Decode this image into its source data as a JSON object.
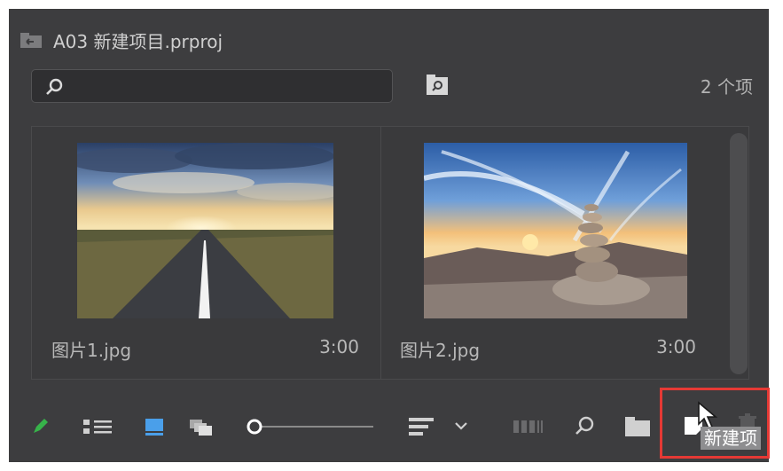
{
  "project": {
    "title": "A03 新建项目.prproj"
  },
  "search": {
    "placeholder": ""
  },
  "item_count": "2 个项",
  "items": [
    {
      "name": "图片1.jpg",
      "duration": "3:00",
      "thumbnail": "road-sunset-thumbnail"
    },
    {
      "name": "图片2.jpg",
      "duration": "3:00",
      "thumbnail": "stone-cairn-sunset-thumbnail"
    }
  ],
  "toolbar": {
    "zoom_level": 0.0,
    "tooltip": "新建项",
    "buttons": [
      "pencil-icon",
      "list-view-icon",
      "icon-view-icon",
      "freeform-view-icon",
      "zoom-slider",
      "sort-icon",
      "chevron-down-icon",
      "automate-to-sequence-icon",
      "find-icon",
      "new-bin-icon",
      "new-item-icon",
      "clear-icon"
    ]
  },
  "colors": {
    "panel_bg": "#3d3d3f",
    "accent_blue": "#4a9fea",
    "pencil_green": "#37b34a",
    "highlight_red": "#e53935"
  }
}
